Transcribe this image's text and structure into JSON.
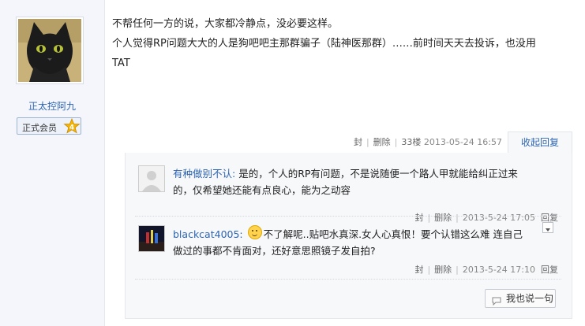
{
  "author": {
    "name": "正太控阿九",
    "member_label": "正式会员",
    "level": "4"
  },
  "post": {
    "lines": [
      "不帮任何一方的说，大家都冷静点，没必要这样。",
      "个人觉得RP问题大大的人是狗吧吧主那群骗子（陆神医那群）……前时间天天去投诉，也没用",
      "TAT"
    ],
    "meta": {
      "block": "封",
      "delete": "删除",
      "floor": "33楼",
      "time": "2013-05-24 16:57"
    },
    "collapse_label": "收起回复"
  },
  "comments": [
    {
      "user": "有种做别不认:",
      "text_line1": "是的，个人的RP有问题，不是说随便一个路人甲就能给纠正过来",
      "text_line2": "的，仅希望她还能有点良心，能为之动容",
      "block": "封",
      "delete": "删除",
      "time": "2013-5-24 17:05",
      "reply": "回复"
    },
    {
      "user": "blackcat4005:",
      "text_line1": "不了解呢..贴吧水真深.女人心真恨！要个认错这么难 连自己",
      "text_line2": "做过的事都不肯面对，还好意思照镜子发自拍?",
      "block": "封",
      "delete": "删除",
      "time": "2013-5-24 17:10",
      "reply": "回复"
    }
  ],
  "say_button_label": "我也说一句",
  "colors": {
    "link": "#2d64b3",
    "sidebar_bg": "#f4f6fb",
    "reply_bg": "#f7f8fa"
  }
}
